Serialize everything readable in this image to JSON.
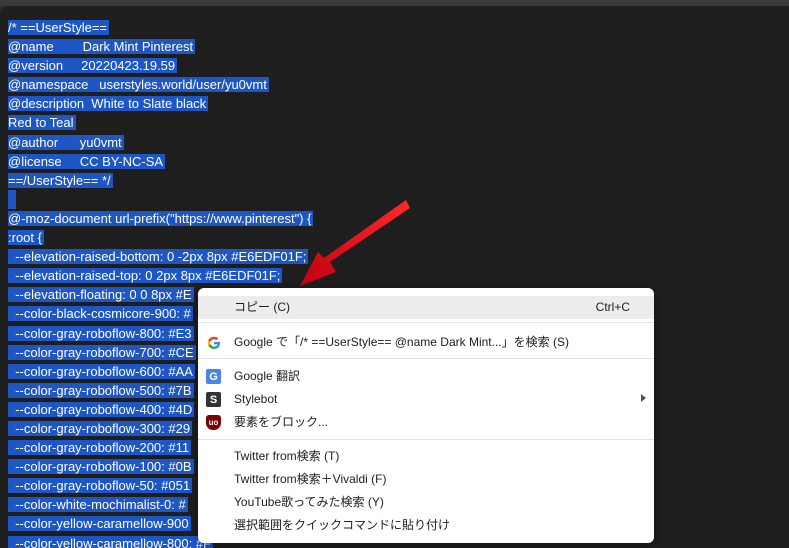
{
  "code_lines": [
    "/* ==UserStyle==",
    "@name        Dark Mint Pinterest",
    "@version     20220423.19.59",
    "@namespace   userstyles.world/user/yu0vmt",
    "@description  White to Slate black",
    "Red to Teal",
    "@author      yu0vmt",
    "@license     CC BY-NC-SA",
    "==/UserStyle== */",
    "",
    "@-moz-document url-prefix(\"https://www.pinterest\") {",
    ":root {",
    "  --elevation-raised-bottom: 0 -2px 8px #E6EDF01F;",
    "  --elevation-raised-top: 0 2px 8px #E6EDF01F;",
    "  --elevation-floating: 0 0 8px #E",
    "  --color-black-cosmicore-900: #",
    "  --color-gray-roboflow-800: #E3",
    "  --color-gray-roboflow-700: #CE",
    "  --color-gray-roboflow-600: #AA",
    "  --color-gray-roboflow-500: #7B",
    "  --color-gray-roboflow-400: #4D",
    "  --color-gray-roboflow-300: #29",
    "  --color-gray-roboflow-200: #11",
    "  --color-gray-roboflow-100: #0B",
    "  --color-gray-roboflow-50: #051",
    "  --color-white-mochimalist-0: #",
    "  --color-yellow-caramellow-900",
    "  --color-yellow-caramellow-800: #F"
  ],
  "context_menu": {
    "copy": {
      "label": "コピー (C)",
      "shortcut": "Ctrl+C"
    },
    "search_google": {
      "label": "Google で「/* ==UserStyle== @name        Dark Mint...」を検索 (S)",
      "icon": "google-icon"
    },
    "google_translate": {
      "label": "Google 翻訳",
      "icon": "google-translate-icon"
    },
    "stylebot": {
      "label": "Stylebot",
      "icon": "stylebot-icon"
    },
    "block_element": {
      "label": "要素をブロック...",
      "icon": "ublock-icon"
    },
    "twitter_search": {
      "label": "Twitter from検索 (T)"
    },
    "twitter_vivaldi": {
      "label": "Twitter from検索＋Vivaldi (F)"
    },
    "youtube_search": {
      "label": "YouTube歌ってみた検索 (Y)"
    },
    "quick_command": {
      "label": "選択範囲をクイックコマンドに貼り付け"
    }
  },
  "colors": {
    "selection": "#1e56c4",
    "editor_bg": "#1e1e1e",
    "arrow": "#e0101a",
    "menu_bg": "#ffffff",
    "menu_highlight": "#ececec"
  }
}
